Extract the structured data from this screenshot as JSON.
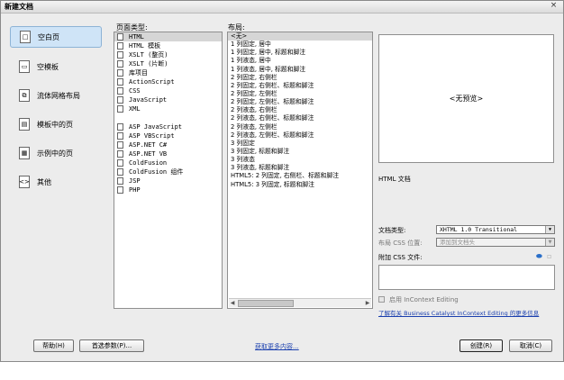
{
  "window": {
    "title": "新建文档",
    "close": "×"
  },
  "categories": [
    {
      "label": "空白页",
      "icon": "□"
    },
    {
      "label": "空模板",
      "icon": "▭"
    },
    {
      "label": "流体网格布局",
      "icon": "⧉"
    },
    {
      "label": "模板中的页",
      "icon": "▤"
    },
    {
      "label": "示例中的页",
      "icon": "▦"
    },
    {
      "label": "其他",
      "icon": "<>"
    }
  ],
  "page_type": {
    "label": "页面类型:",
    "items": [
      "HTML",
      "HTML 模板",
      "XSLT (整页)",
      "XSLT (片断)",
      "库项目",
      "ActionScript",
      "CSS",
      "JavaScript",
      "XML",
      "",
      "ASP JavaScript",
      "ASP VBScript",
      "ASP.NET C#",
      "ASP.NET VB",
      "ColdFusion",
      "ColdFusion 组件",
      "JSP",
      "PHP"
    ]
  },
  "layout": {
    "label": "布局:",
    "items": [
      "<无>",
      "1 列固定, 居中",
      "1 列固定, 居中, 标题和脚注",
      "1 列液态, 居中",
      "1 列液态, 居中, 标题和脚注",
      "2 列固定, 右侧栏",
      "2 列固定, 右侧栏、标题和脚注",
      "2 列固定, 左侧栏",
      "2 列固定, 左侧栏、标题和脚注",
      "2 列液态, 右侧栏",
      "2 列液态, 右侧栏、标题和脚注",
      "2 列液态, 左侧栏",
      "2 列液态, 左侧栏、标题和脚注",
      "3 列固定",
      "3 列固定, 标题和脚注",
      "3 列液态",
      "3 列液态, 标题和脚注",
      "HTML5: 2 列固定, 右侧栏、标题和脚注",
      "HTML5: 3 列固定, 标题和脚注"
    ]
  },
  "preview": {
    "text": "<无预览>",
    "caption": "HTML 文档"
  },
  "options": {
    "doctype_label": "文档类型:",
    "doctype_value": "XHTML 1.0 Transitional",
    "css_position_label": "布局 CSS 位置:",
    "css_position_value": "添加到文档头",
    "attach_css_label": "附加 CSS 文件:",
    "incontext_label": "启用 InContext Editing",
    "learn_more": "了解有关 Business Catalyst InContext Editing 的更多信息"
  },
  "footer": {
    "help": "帮助(H)",
    "prefs": "首选参数(P)...",
    "more_content": "获取更多内容...",
    "create": "创建(R)",
    "cancel": "取消(C)"
  }
}
